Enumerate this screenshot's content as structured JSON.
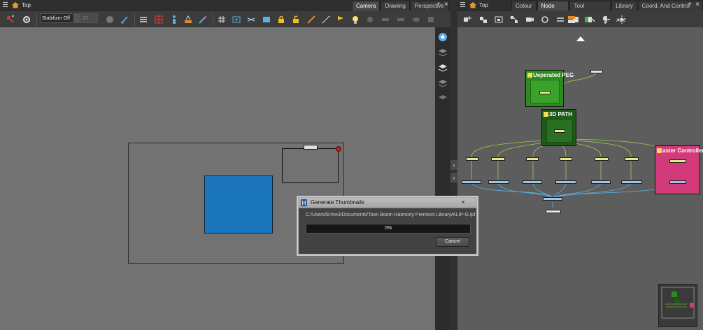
{
  "left_panel": {
    "view_title": "Top",
    "tabs": [
      {
        "label": "Camera",
        "active": true
      },
      {
        "label": "Drawing",
        "active": false
      },
      {
        "label": "Perspective",
        "active": false
      }
    ],
    "toolbar": {
      "stabilizer_label": "Stabilizer Off",
      "stabilizer_value": "20",
      "icons": [
        "transform-tool-icon",
        "gear-icon",
        "stabilizer-icon",
        "brush-icon",
        "layers-up-icon",
        "grid-red-icon",
        "person-icon",
        "onion-skin-icon",
        "pen-tool-icon",
        "grid-icon",
        "view-icon",
        "tilt-icon",
        "lock-icon",
        "lock-open-icon",
        "pencil-icon",
        "line-icon",
        "flag-icon",
        "bulb-icon"
      ]
    }
  },
  "right_panel": {
    "view_title": "Top",
    "tabs": [
      {
        "label": "Colour",
        "active": false
      },
      {
        "label": "Node View",
        "active": true
      },
      {
        "label": "Tool Properties",
        "active": false
      },
      {
        "label": "Library",
        "active": false
      },
      {
        "label": "Coord. And Control Points",
        "active": false
      }
    ],
    "node_groups": [
      {
        "title": "Ueperated PEG",
        "color": "#2e8b1f"
      },
      {
        "title": "3D PATH",
        "color": "#1f5a1a"
      },
      {
        "title": "aster Controller",
        "color": "#d23a7a"
      }
    ]
  },
  "dialog": {
    "title": "Generate Thumbnails",
    "close_label": "×",
    "path": "C:/Users/Emre3/Documents/Toon Boom Harmony Premium Library/KLIP-G.tpl",
    "progress_text": "0%",
    "progress_value": 0,
    "cancel_label": "Cancel"
  },
  "colors": {
    "blue_fill": "#1b75bb",
    "red_dot": "#e21010",
    "progress_fill": "#2d6fb8",
    "green_group": "#2e8b1f",
    "pink_group": "#d23a7a"
  }
}
